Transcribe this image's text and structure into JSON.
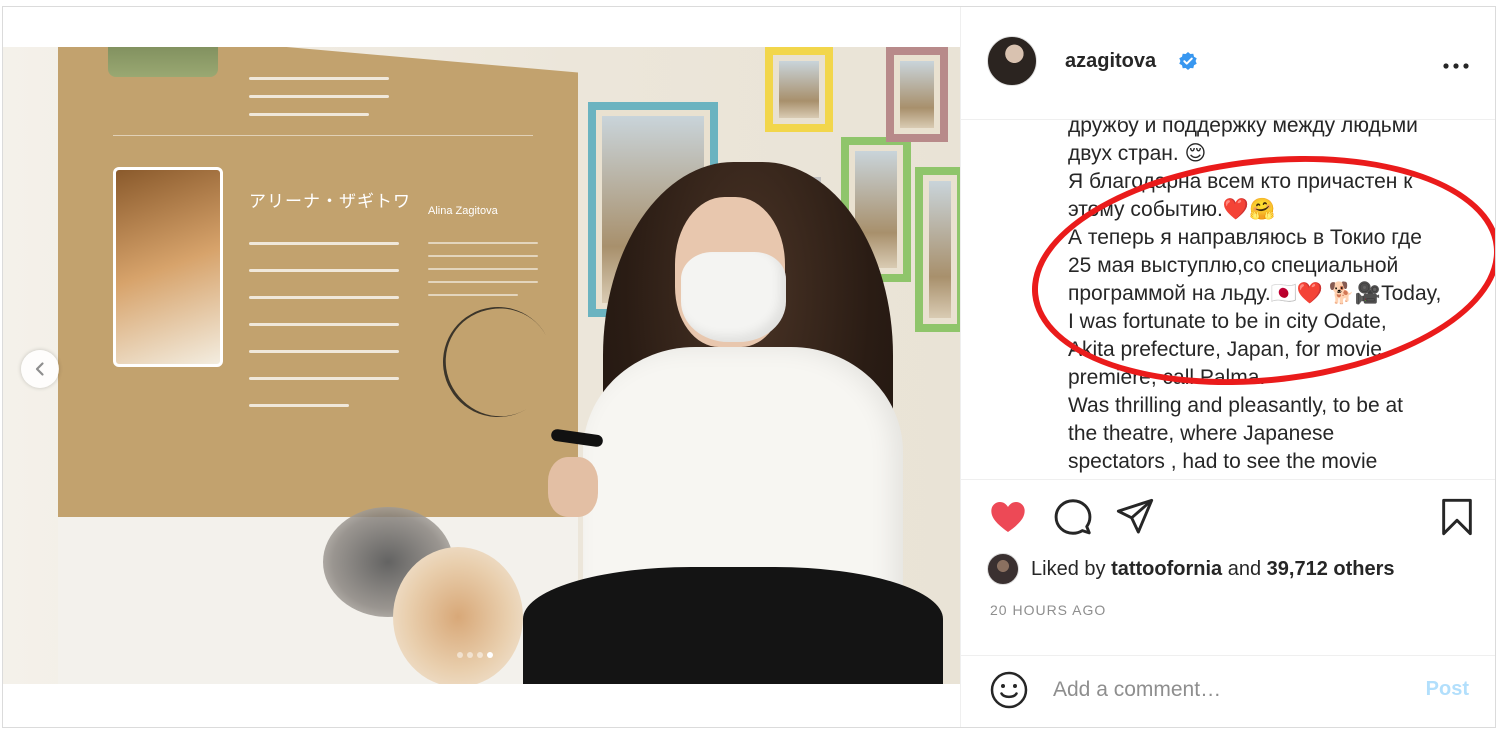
{
  "post": {
    "username": "azagitova",
    "verified": true,
    "caption_lines": [
      "дружбу и поддержку между людьми",
      "двух стран. 😌",
      "Я благодарна всем кто причастен к",
      "этому событию.❤️🤗",
      "А теперь я направляюсь в Токио где",
      "25 мая выступлю,со специальной",
      "программой на льду.🇯🇵❤️ 🐕🎥Today,",
      "I was fortunate to be in city Odate,",
      "Akita prefecture, Japan, for movie",
      "premiere, call Palma.",
      "Was thrilling and pleasantly, to be at",
      "the theatre, where Japanese",
      "spectators , had to see the movie"
    ],
    "likes": {
      "prefix": "Liked by",
      "user": "tattoofornia",
      "middle": "and",
      "count": "39,712 others"
    },
    "timestamp": "20 HOURS AGO",
    "liked_state": true
  },
  "media": {
    "jp_name": "アリーナ・ザギトワ",
    "en_name": "Alina Zagitova",
    "slide_count": 4,
    "active_slide": 4
  },
  "comment": {
    "placeholder": "Add a comment…",
    "post_label": "Post"
  },
  "icons": {
    "like": "heart-filled-icon",
    "comment": "speech-bubble-icon",
    "share": "paper-plane-icon",
    "save": "bookmark-icon",
    "emoji": "smiley-icon",
    "more": "ellipsis-icon",
    "prev": "chevron-left-icon",
    "verified": "verified-badge-icon"
  },
  "colors": {
    "like": "#ed4956",
    "verified": "#3897f0",
    "annotation_oval": "#ea1b1b",
    "post_button_disabled": "#b2dffc"
  }
}
